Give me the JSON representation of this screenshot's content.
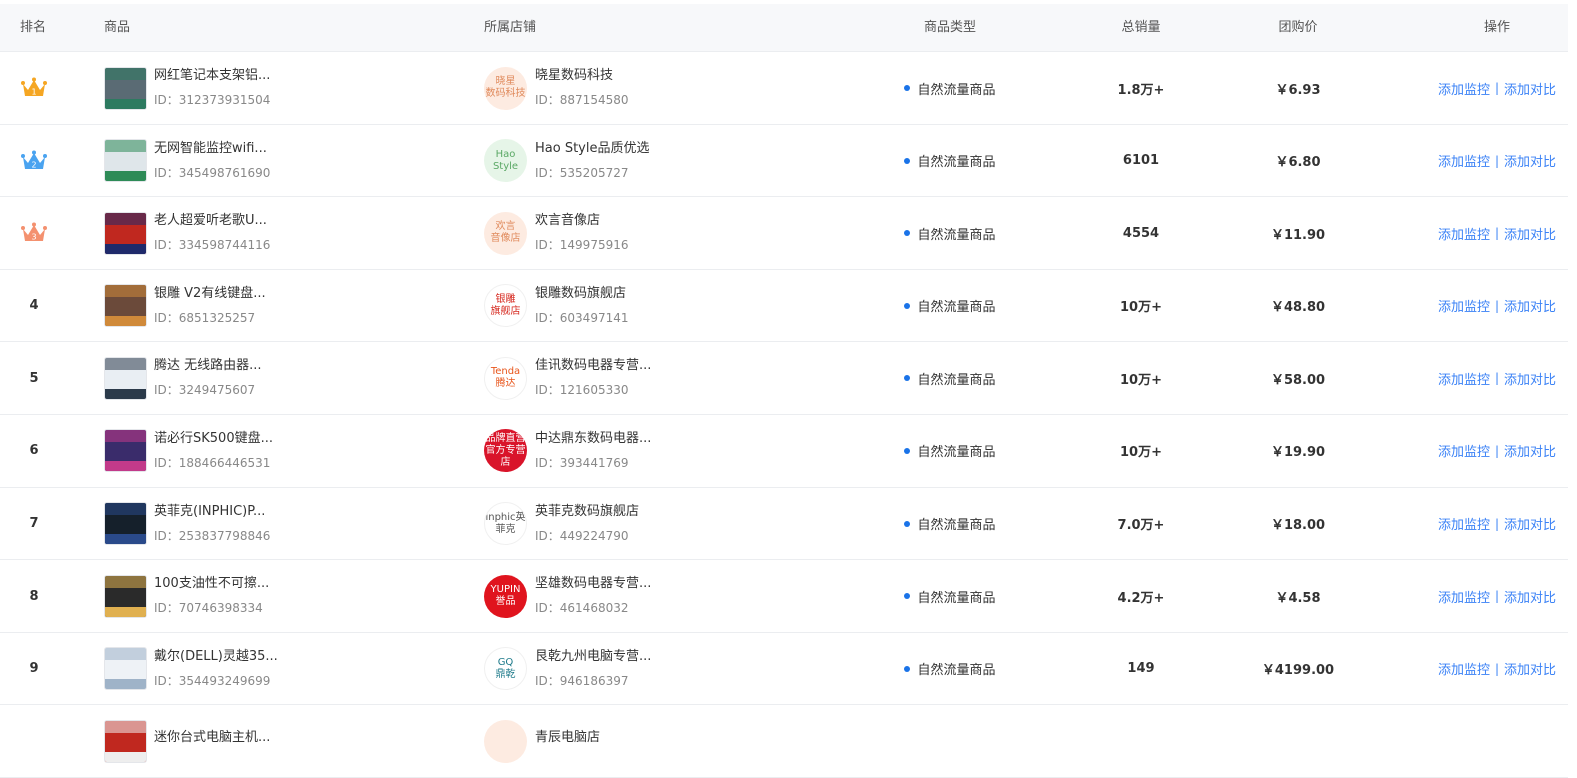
{
  "header": {
    "rank": "排名",
    "product": "商品",
    "shop": "所属店铺",
    "type": "商品类型",
    "sales": "总销量",
    "price": "团购价",
    "ops": "操作"
  },
  "actions": {
    "monitor": "添加监控",
    "compare": "添加对比",
    "separator": "|"
  },
  "crown_colors": [
    "#f5a623",
    "#4aa3f0",
    "#f4916f"
  ],
  "rows": [
    {
      "rank": "1",
      "crown": true,
      "title": "网红笔记本支架铝...",
      "id": "ID：312373931504",
      "thumb": [
        "#5a6b74",
        "#2d7a60"
      ],
      "shop_logo": "晓星\n数码科技",
      "logo_bg": "#fdebe1",
      "logo_fg": "#e08a5c",
      "shop": "晓星数码科技",
      "shop_id": "ID：887154580",
      "type": "自然流量商品",
      "sales": "1.8万+",
      "price": "￥6.93"
    },
    {
      "rank": "2",
      "crown": true,
      "title": "无网智能监控wifi...",
      "id": "ID：345498761690",
      "thumb": [
        "#dfe6ea",
        "#2e8b57"
      ],
      "shop_logo": "Hao\nStyle",
      "logo_bg": "#e6f5e8",
      "logo_fg": "#5aa865",
      "shop": "Hao Style品质优选",
      "shop_id": "ID：535205727",
      "type": "自然流量商品",
      "sales": "6101",
      "price": "￥6.80"
    },
    {
      "rank": "3",
      "crown": true,
      "title": "老人超爱听老歌U...",
      "id": "ID：334598744116",
      "thumb": [
        "#c0281f",
        "#1f2a6b"
      ],
      "shop_logo": "欢言\n音像店",
      "logo_bg": "#fdebe1",
      "logo_fg": "#e08a5c",
      "shop": "欢言音像店",
      "shop_id": "ID：149975916",
      "type": "自然流量商品",
      "sales": "4554",
      "price": "￥11.90"
    },
    {
      "rank": "4",
      "crown": false,
      "title": "银雕 V2有线键盘...",
      "id": "ID：6851325257",
      "thumb": [
        "#6b4a3a",
        "#d08a3a"
      ],
      "shop_logo": "银雕\n旗舰店",
      "logo_bg": "#ffffff",
      "logo_fg": "#d6261c",
      "shop": "银雕数码旗舰店",
      "shop_id": "ID：603497141",
      "type": "自然流量商品",
      "sales": "10万+",
      "price": "￥48.80"
    },
    {
      "rank": "5",
      "crown": false,
      "title": "腾达 无线路由器...",
      "id": "ID：3249475607",
      "thumb": [
        "#e9eef3",
        "#2b3a4a"
      ],
      "shop_logo": "Tenda\n腾达",
      "logo_bg": "#ffffff",
      "logo_fg": "#e8561c",
      "shop": "佳讯数码电器专营...",
      "shop_id": "ID：121605330",
      "type": "自然流量商品",
      "sales": "10万+",
      "price": "￥58.00"
    },
    {
      "rank": "6",
      "crown": false,
      "title": "诺必行SK500键盘...",
      "id": "ID：188466446531",
      "thumb": [
        "#3a2c6b",
        "#c23a8a"
      ],
      "shop_logo": "品牌直营\n官方专营店",
      "logo_bg": "#d9142a",
      "logo_fg": "#ffffff",
      "shop": "中达鼎东数码电器...",
      "shop_id": "ID：393441769",
      "type": "自然流量商品",
      "sales": "10万+",
      "price": "￥19.90"
    },
    {
      "rank": "7",
      "crown": false,
      "title": "英菲克(INPHIC)P...",
      "id": "ID：253837798846",
      "thumb": [
        "#15202b",
        "#2a4a8a"
      ],
      "shop_logo": "inphic英菲克",
      "logo_bg": "#ffffff",
      "logo_fg": "#555555",
      "shop": "英菲克数码旗舰店",
      "shop_id": "ID：449224790",
      "type": "自然流量商品",
      "sales": "7.0万+",
      "price": "￥18.00"
    },
    {
      "rank": "8",
      "crown": false,
      "title": "100支油性不可擦...",
      "id": "ID：70746398334",
      "thumb": [
        "#2a2a2a",
        "#e0b050"
      ],
      "shop_logo": "YUPIN\n誉品",
      "logo_bg": "#e0141e",
      "logo_fg": "#ffffff",
      "shop": "坚雄数码电器专营...",
      "shop_id": "ID：461468032",
      "type": "自然流量商品",
      "sales": "4.2万+",
      "price": "￥4.58"
    },
    {
      "rank": "9",
      "crown": false,
      "title": "戴尔(DELL)灵越35...",
      "id": "ID：354493249699",
      "thumb": [
        "#eef2f6",
        "#9fb3c8"
      ],
      "shop_logo": "GQ\n鼎乾",
      "logo_bg": "#ffffff",
      "logo_fg": "#1d7a8a",
      "shop": "艮乾九州电脑专营...",
      "shop_id": "ID：946186397",
      "type": "自然流量商品",
      "sales": "149",
      "price": "￥4199.00"
    },
    {
      "rank": "",
      "crown": false,
      "title": "迷你台式电脑主机...",
      "id": "",
      "thumb": [
        "#c0281f",
        "#eeeeee"
      ],
      "shop_logo": "",
      "logo_bg": "#fdebe1",
      "logo_fg": "#e08a5c",
      "shop": "青辰电脑店",
      "shop_id": "",
      "type": "",
      "sales": "",
      "price": ""
    }
  ]
}
